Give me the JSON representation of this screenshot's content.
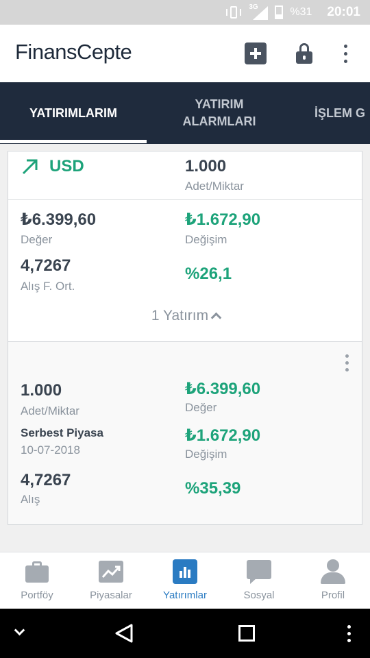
{
  "status_bar": {
    "network": "3G",
    "battery": "%31",
    "time": "20:01"
  },
  "header": {
    "logo": "FinansCepte",
    "add_icon": "plus-square-icon",
    "lock_icon": "lock-icon",
    "more_icon": "more-vert-icon"
  },
  "tabs": [
    {
      "label": "YATIRIMLARIM",
      "active": true
    },
    {
      "label": "YATIRIM ALARMLARI",
      "active": false
    },
    {
      "label": "İŞLEM G",
      "active": false
    }
  ],
  "summary_card": {
    "trend_icon": "trend-up-arrow-icon",
    "symbol": "USD",
    "quantity": "1.000",
    "quantity_label": "Adet/Miktar",
    "value": "₺6.399,60",
    "value_label": "Değer",
    "change": "₺1.672,90",
    "change_label": "Değişim",
    "avg_price": "4,7267",
    "avg_price_label": "Alış F. Ort.",
    "change_pct": "%26,1",
    "expand_label": "1 Yatırım"
  },
  "investment_card": {
    "more_icon": "more-vert-icon",
    "quantity": "1.000",
    "quantity_label": "Adet/Miktar",
    "market": "Serbest Piyasa",
    "date": "10-07-2018",
    "buy_price": "4,7267",
    "buy_price_label": "Alış",
    "value": "₺6.399,60",
    "value_label": "Değer",
    "change": "₺1.672,90",
    "change_label": "Değişim",
    "change_pct": "%35,39"
  },
  "bottom_nav": [
    {
      "label": "Portföy",
      "icon": "briefcase-icon",
      "active": false
    },
    {
      "label": "Piyasalar",
      "icon": "chart-trend-icon",
      "active": false
    },
    {
      "label": "Yatırımlar",
      "icon": "bar-chart-icon",
      "active": true
    },
    {
      "label": "Sosyal",
      "icon": "chat-bubble-icon",
      "active": false
    },
    {
      "label": "Profil",
      "icon": "user-icon",
      "active": false
    }
  ],
  "colors": {
    "tab_bar": "#1f2b3d",
    "positive": "#1da37a",
    "active_nav": "#2a7bc2"
  }
}
